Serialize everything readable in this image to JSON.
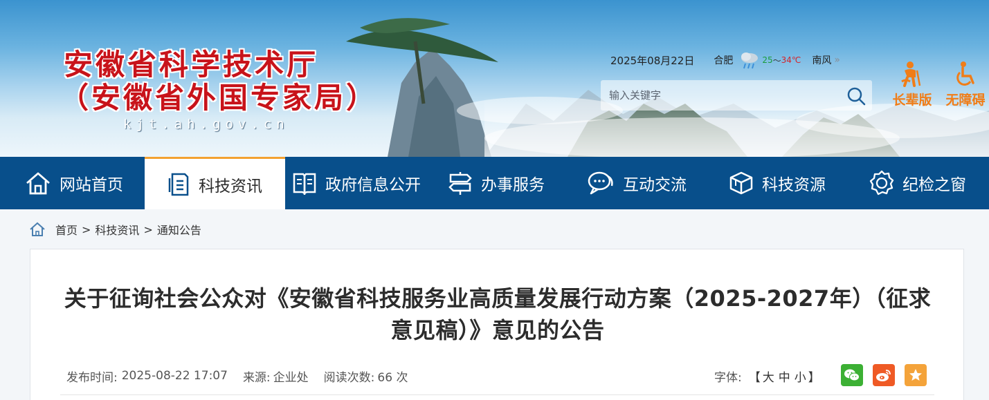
{
  "banner": {
    "title_line1": "安徽省科学技术厅",
    "title_line2": "（安徽省外国专家局）",
    "domain": "kjt.ah.gov.cn",
    "date": "2025年08月22日",
    "city": "合肥",
    "temp_low": "25",
    "temp_sep": "～",
    "temp_high": "34℃",
    "wind": "南风",
    "weather_icon": "rain-cloud-icon",
    "search_placeholder": "输入关键字",
    "elder_label": "长辈版",
    "accessible_label": "无障碍",
    "colors": {
      "title_red": "#c8131a",
      "tool_orange": "#f07d18"
    }
  },
  "nav": {
    "items": [
      {
        "label": "网站首页",
        "icon": "home-icon"
      },
      {
        "label": "科技资讯",
        "icon": "document-icon",
        "active": true
      },
      {
        "label": "政府信息公开",
        "icon": "book-icon"
      },
      {
        "label": "办事服务",
        "icon": "signpost-icon"
      },
      {
        "label": "互动交流",
        "icon": "chat-icon"
      },
      {
        "label": "科技资源",
        "icon": "cube-icon"
      },
      {
        "label": "纪检之窗",
        "icon": "badge-icon"
      }
    ],
    "colors": {
      "bar": "#084f8b",
      "active_accent": "#f3a130"
    }
  },
  "breadcrumb": {
    "items": [
      "首页",
      "科技资讯",
      "通知公告"
    ],
    "separator": ">"
  },
  "article": {
    "title_line1": "关于征询社会公众对《安徽省科技服务业高质量发展行动方案（2025-2027年）（征求",
    "title_line2": "意见稿）》意见的公告",
    "publish_label": "发布时间:",
    "publish_time": "2025-08-22 17:07",
    "source_label": "来源:",
    "source": "企业处",
    "reads_label": "阅读次数:",
    "reads": "66 次",
    "font_label": "字体:",
    "font_open": "【",
    "font_large": "大",
    "font_medium": "中",
    "font_small": "小",
    "font_close": "】"
  },
  "share": {
    "wechat_icon": "wechat-icon",
    "weibo_icon": "weibo-icon",
    "favorite_icon": "star-icon"
  }
}
